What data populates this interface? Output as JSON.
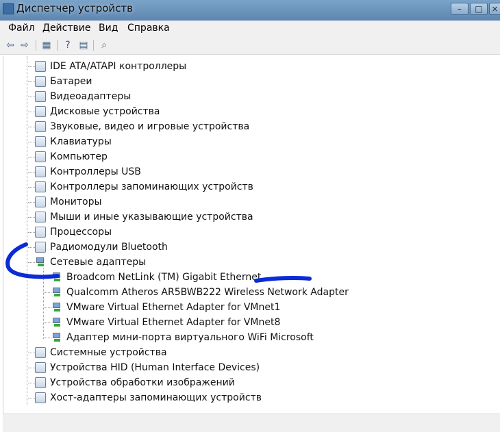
{
  "window": {
    "title": "Диспетчер устройств"
  },
  "menu": {
    "items": [
      "Файл",
      "Действие",
      "Вид",
      "Справка"
    ]
  },
  "toolbar": {
    "icons": [
      "back-icon",
      "forward-icon",
      "properties-icon",
      "help-icon",
      "details-icon",
      "scan-icon"
    ]
  },
  "tree": {
    "categories": [
      {
        "label": "IDE ATA/ATAPI контроллеры"
      },
      {
        "label": "Батареи"
      },
      {
        "label": "Видеоадаптеры"
      },
      {
        "label": "Дисковые устройства"
      },
      {
        "label": "Звуковые, видео и игровые устройства"
      },
      {
        "label": "Клавиатуры"
      },
      {
        "label": "Компьютер"
      },
      {
        "label": "Контроллеры USB"
      },
      {
        "label": "Контроллеры запоминающих устройств"
      },
      {
        "label": "Мониторы"
      },
      {
        "label": "Мыши и иные указывающие устройства"
      },
      {
        "label": "Процессоры"
      },
      {
        "label": "Радиомодули Bluetooth"
      },
      {
        "label": "Сетевые адаптеры"
      },
      {
        "label": "Системные устройства"
      },
      {
        "label": "Устройства HID (Human Interface Devices)"
      },
      {
        "label": "Устройства обработки изображений"
      },
      {
        "label": "Хост-адаптеры запоминающих устройств"
      }
    ],
    "network_adapters": [
      {
        "label": "Broadcom NetLink (TM) Gigabit Ethernet"
      },
      {
        "label": "Qualcomm Atheros AR5BWB222 Wireless Network Adapter"
      },
      {
        "label": "VMware Virtual Ethernet Adapter for VMnet1"
      },
      {
        "label": "VMware Virtual Ethernet Adapter for VMnet8"
      },
      {
        "label": "Адаптер мини-порта виртуального WiFi Microsoft"
      }
    ]
  },
  "colors": {
    "annotation": "#0a2bd6",
    "titlebar": "#6a91b8"
  }
}
